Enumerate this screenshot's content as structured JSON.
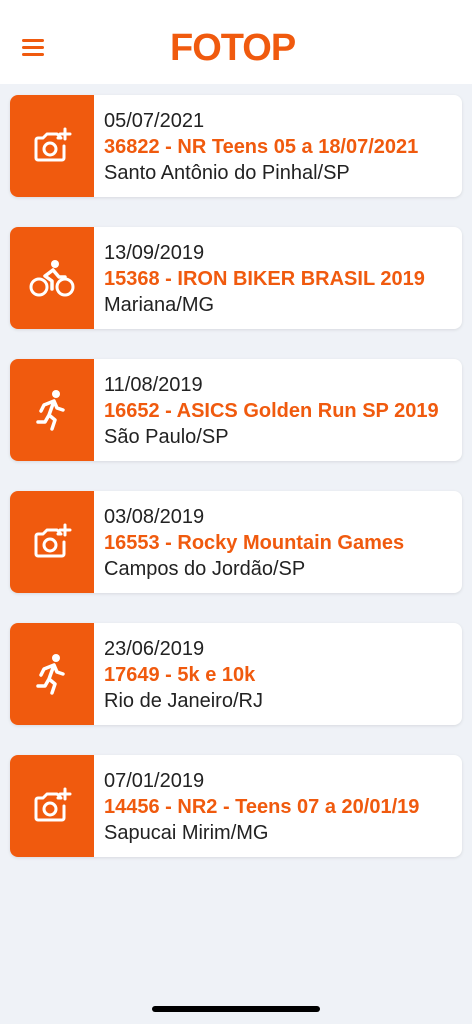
{
  "header": {
    "logo_text": "FOTOP",
    "menu_icon": "hamburger-menu-icon"
  },
  "colors": {
    "accent": "#f05a0e",
    "background": "#eff2f7",
    "card": "#ffffff",
    "text": "#222222"
  },
  "events": [
    {
      "icon": "add-photo-icon",
      "date": "05/07/2021",
      "title": "36822 - NR Teens 05 a 18/07/2021",
      "city": "Santo Antônio do Pinhal/SP"
    },
    {
      "icon": "cycling-icon",
      "date": "13/09/2019",
      "title": "15368 - IRON BIKER BRASIL 2019",
      "city": "Mariana/MG"
    },
    {
      "icon": "running-icon",
      "date": "11/08/2019",
      "title": "16652 - ASICS Golden Run SP 2019",
      "city": "São Paulo/SP"
    },
    {
      "icon": "add-photo-icon",
      "date": "03/08/2019",
      "title": "16553 - Rocky Mountain Games",
      "city": "Campos do Jordão/SP"
    },
    {
      "icon": "running-icon",
      "date": "23/06/2019",
      "title": "17649 - 5k e 10k",
      "city": "Rio de Janeiro/RJ"
    },
    {
      "icon": "add-photo-icon",
      "date": "07/01/2019",
      "title": "14456 - NR2 - Teens 07 a 20/01/19",
      "city": "Sapucai Mirim/MG"
    }
  ]
}
